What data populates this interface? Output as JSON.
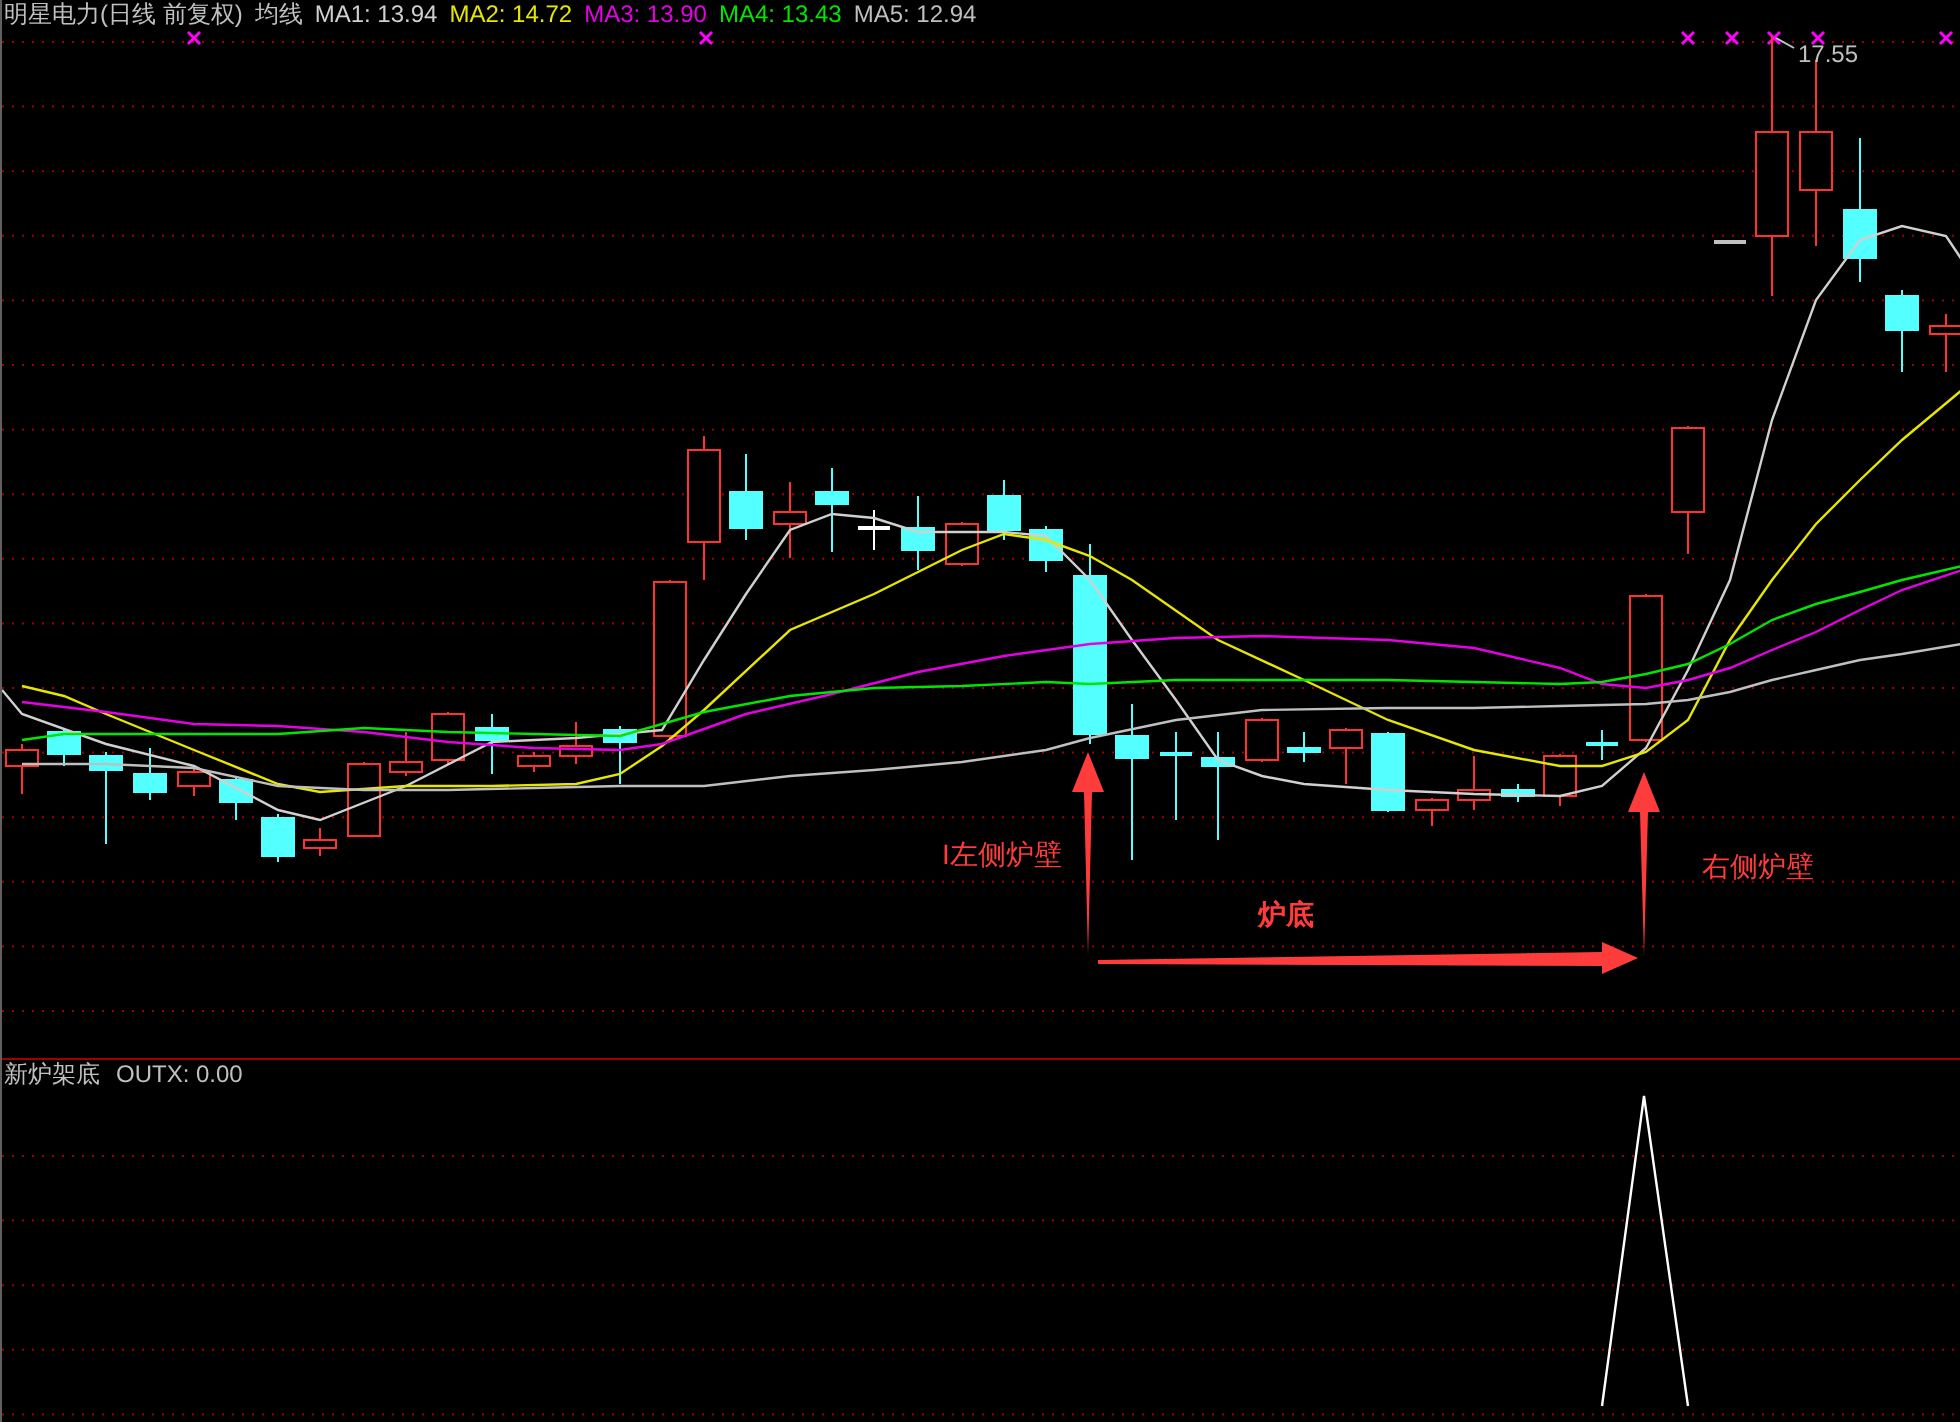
{
  "chart_title": "明星电力(日线 前复权)",
  "indicator_name": "均线",
  "moving_averages": [
    {
      "label": "MA1:",
      "value": "13.94",
      "color": "#d0d0d0"
    },
    {
      "label": "MA2:",
      "value": "14.72",
      "color": "#e6e600"
    },
    {
      "label": "MA3:",
      "value": "13.90",
      "color": "#e600e6"
    },
    {
      "label": "MA4:",
      "value": "13.43",
      "color": "#00e600"
    },
    {
      "label": "MA5:",
      "value": "12.94",
      "color": "#bfbfbf"
    }
  ],
  "price_label": "17.55",
  "annotations": [
    {
      "text": "I左侧炉壁",
      "bold": false
    },
    {
      "text": "炉底",
      "bold": true
    },
    {
      "text": "右侧炉壁",
      "bold": false
    }
  ],
  "sub_panel": {
    "title": "新炉架底",
    "reading": "OUTX: 0.00"
  }
}
